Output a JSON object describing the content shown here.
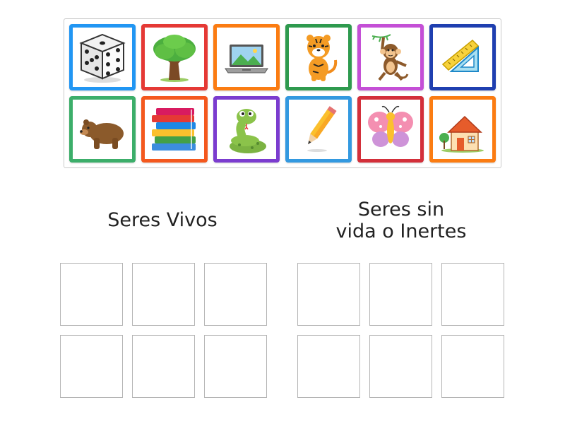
{
  "tiles": [
    {
      "icon": "dice-icon",
      "border": "#2196f3"
    },
    {
      "icon": "tree-icon",
      "border": "#e53935"
    },
    {
      "icon": "laptop-icon",
      "border": "#fb7c12"
    },
    {
      "icon": "tiger-icon",
      "border": "#2e9a4e"
    },
    {
      "icon": "monkey-icon",
      "border": "#c44fd6"
    },
    {
      "icon": "ruler-icon",
      "border": "#1f3fb0"
    },
    {
      "icon": "bear-icon",
      "border": "#3cae6a"
    },
    {
      "icon": "books-icon",
      "border": "#f4581e"
    },
    {
      "icon": "snake-icon",
      "border": "#7b3ccf"
    },
    {
      "icon": "pencil-icon",
      "border": "#3399e0"
    },
    {
      "icon": "butterfly-icon",
      "border": "#d32f3a"
    },
    {
      "icon": "house-icon",
      "border": "#fb7c12"
    }
  ],
  "groups": {
    "living": {
      "line1": "Seres Vivos"
    },
    "inert": {
      "line1": "Seres sin",
      "line2": "vida o Inertes"
    }
  }
}
